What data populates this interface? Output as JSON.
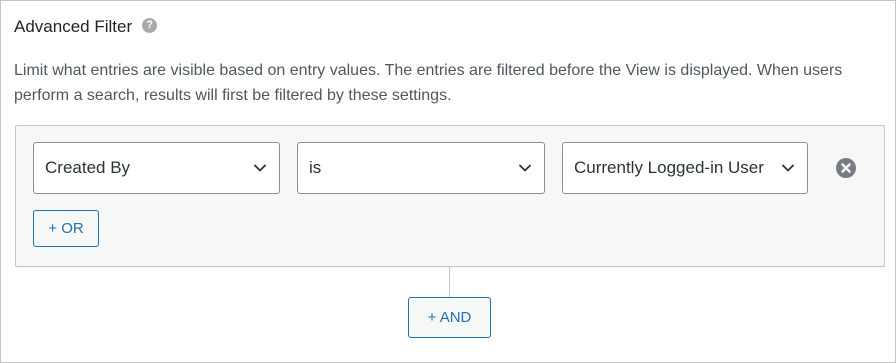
{
  "filter": {
    "title": "Advanced Filter",
    "help_icon": "question-circle-icon",
    "description": "Limit what entries are visible based on entry values. The entries are filtered before the View is displayed. When users perform a search, results will first be filtered by these settings.",
    "condition": {
      "field": "Created By",
      "operator": "is",
      "value": "Currently Logged-in User",
      "remove_icon": "close-circle-icon"
    },
    "or_button": "+ OR",
    "and_button": "+ AND"
  },
  "colors": {
    "accent": "#2271b1",
    "border": "#c3c4c7",
    "group_bg": "#f6f7f7",
    "icon_gray": "#787c82"
  }
}
